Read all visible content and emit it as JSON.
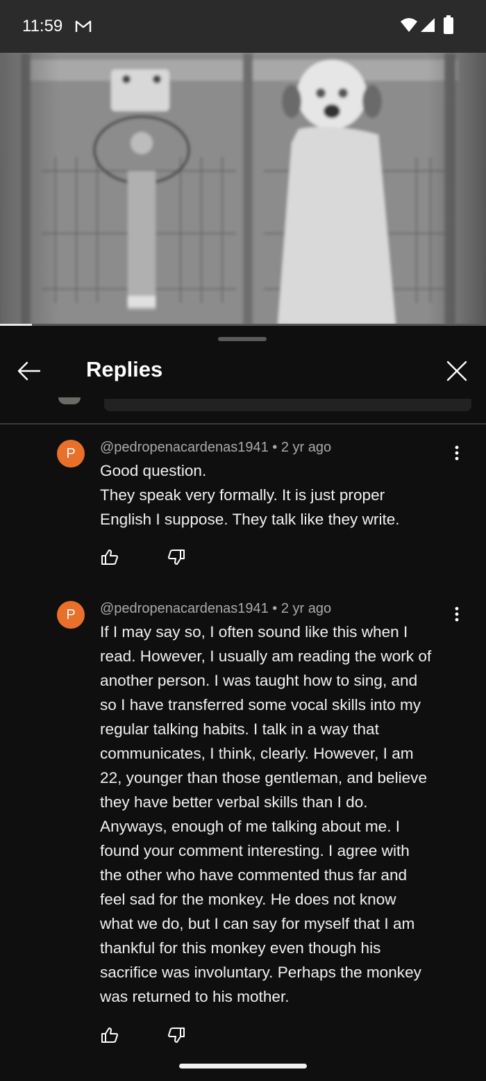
{
  "status_bar": {
    "time": "11:59"
  },
  "video": {
    "progress_fraction": 0.065
  },
  "sheet": {
    "title": "Replies"
  },
  "replies": [
    {
      "avatar_letter": "P",
      "author": "@pedropenacardenas1941",
      "separator": "•",
      "age": "2 yr ago",
      "lines": [
        "Good question.",
        "They speak very formally. It is just proper",
        "English I suppose. They talk like they write."
      ]
    },
    {
      "avatar_letter": "P",
      "author": "@pedropenacardenas1941",
      "separator": "•",
      "age": "2 yr ago",
      "lines": [
        "If I may say so, I often sound like this when I",
        "read. However, I usually am reading the work of",
        "another person. I was taught how to sing, and",
        "so I have transferred some vocal skills into my",
        "regular talking habits. I talk in a way that",
        "communicates, I think, clearly. However, I am",
        "22, younger than those gentleman, and believe",
        "they have better verbal skills than I do.",
        "Anyways, enough of me talking about me. I",
        "found your comment interesting. I agree with",
        "the other who have commented thus far and",
        "feel sad for the monkey. He does not know",
        "what we do, but I can say for myself that I am",
        "thankful for this monkey even though his",
        "sacrifice was involuntary. Perhaps the monkey",
        "was returned to his mother."
      ]
    }
  ],
  "colors": {
    "avatar": "#e8702a",
    "background": "#0f0f0f",
    "meta_text": "#aaaaaa"
  }
}
